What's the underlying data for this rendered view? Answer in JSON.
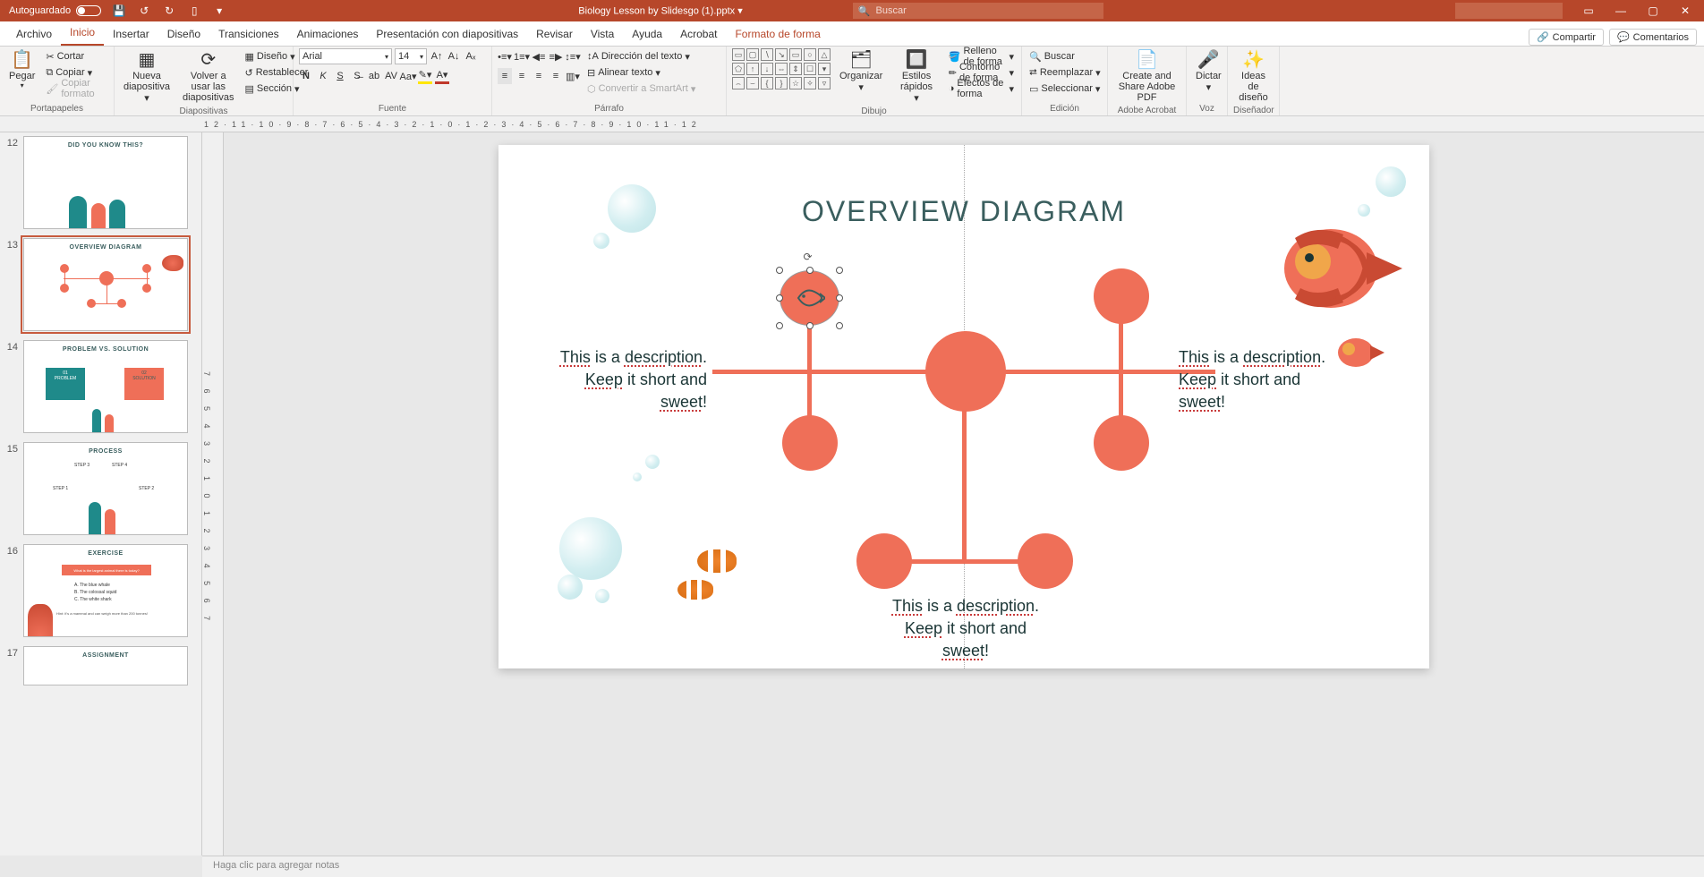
{
  "titlebar": {
    "autosave_label": "Autoguardado",
    "filename": "Biology Lesson by Slidesgo (1).pptx",
    "search_placeholder": "Buscar"
  },
  "tabs": {
    "file": "Archivo",
    "home": "Inicio",
    "insert": "Insertar",
    "design": "Diseño",
    "transitions": "Transiciones",
    "animations": "Animaciones",
    "slideshow": "Presentación con diapositivas",
    "review": "Revisar",
    "view": "Vista",
    "help": "Ayuda",
    "acrobat": "Acrobat",
    "shape_format": "Formato de forma",
    "share": "Compartir",
    "comments": "Comentarios"
  },
  "ribbon": {
    "clipboard": {
      "paste": "Pegar",
      "cut": "Cortar",
      "copy": "Copiar",
      "format_painter": "Copiar formato",
      "label": "Portapapeles"
    },
    "slides": {
      "new_slide": "Nueva diapositiva",
      "reuse": "Volver a usar las diapositivas",
      "layout": "Diseño",
      "reset": "Restablecer",
      "section": "Sección",
      "label": "Diapositivas"
    },
    "font": {
      "name": "Arial",
      "size": "14",
      "label": "Fuente"
    },
    "paragraph": {
      "text_direction": "Dirección del texto",
      "align_text": "Alinear texto",
      "smartart": "Convertir a SmartArt",
      "label": "Párrafo"
    },
    "drawing": {
      "arrange": "Organizar",
      "quick_styles": "Estilos rápidos",
      "shape_fill": "Relleno de forma",
      "shape_outline": "Contorno de forma",
      "shape_effects": "Efectos de forma",
      "label": "Dibujo"
    },
    "editing": {
      "find": "Buscar",
      "replace": "Reemplazar",
      "select": "Seleccionar",
      "label": "Edición"
    },
    "acrobat": {
      "create_share": "Create and Share Adobe PDF",
      "label": "Adobe Acrobat"
    },
    "voice": {
      "dictate": "Dictar",
      "label": "Voz"
    },
    "designer": {
      "ideas": "Ideas de diseño",
      "label": "Diseñador"
    }
  },
  "slide_numbers": [
    "12",
    "13",
    "14",
    "15",
    "16",
    "17"
  ],
  "thumb_titles": {
    "t12": "DID YOU KNOW THIS?",
    "t13": "OVERVIEW DIAGRAM",
    "t14": "PROBLEM VS. SOLUTION",
    "t14_a": "01",
    "t14_b": "PROBLEM",
    "t14_c": "02",
    "t14_d": "SOLUTION",
    "t15": "PROCESS",
    "t15_s1": "STEP 1",
    "t15_s2": "STEP 2",
    "t15_s3": "STEP 3",
    "t15_s4": "STEP 4",
    "t16": "EXERCISE",
    "t16_q": "What is the largest animal there is today?",
    "t16_a": "A.  The blue whale",
    "t16_b": "B.  The colossal squid",
    "t16_c": "C.  The white shark",
    "t16_h": "Hint: it's a mammal and can weigh more than 200 tonnes!",
    "t17": "ASSIGNMENT"
  },
  "slide": {
    "title": "OVERVIEW DIAGRAM",
    "desc_1_a": "This",
    "desc_1_b": " is a ",
    "desc_1_c": "description",
    "desc_1_d": ".",
    "desc_2_a": "Keep",
    "desc_2_b": " it short and",
    "desc_3_a": "sweet",
    "desc_3_b": "!"
  },
  "notes": "Haga clic para agregar notas"
}
